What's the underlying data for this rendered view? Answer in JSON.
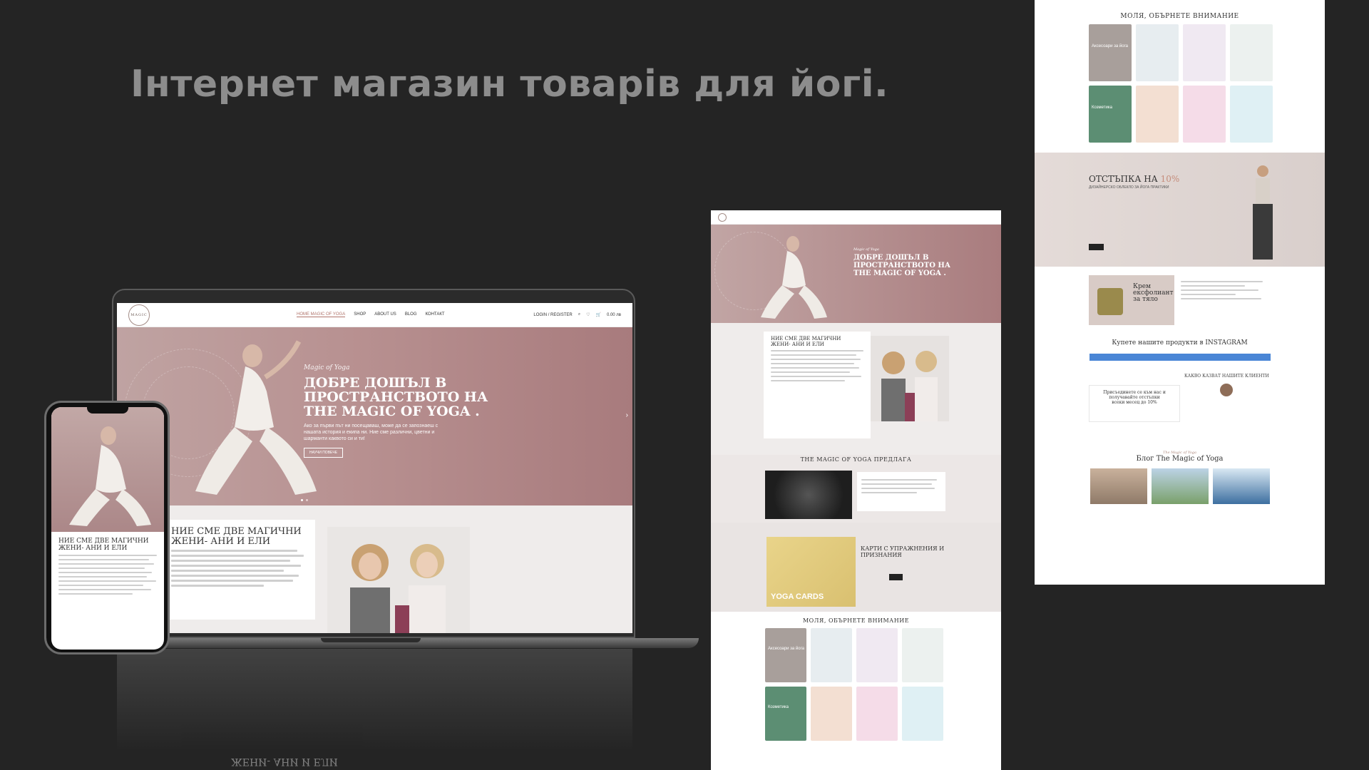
{
  "headline": "Інтернет магазин товарів для йогі.",
  "laptop": {
    "logo": "MAGIC",
    "menu": [
      "HOME MAGIC OF YOGA",
      "SHOP",
      "ABOUT US",
      "BLOG",
      "КОНТАКТ"
    ],
    "login": "LOGIN / REGISTER",
    "cart": "0.00 лв",
    "hero": {
      "kicker": "Magic of Yoga",
      "title_lines": [
        "ДОБРЕ ДОШЪЛ В",
        "ПРОСТРАНСТВОТО НА",
        "THE MAGIC OF YOGA ."
      ],
      "subtitle": "Ако за първи път ни посещаваш, може да се запознаеш с нашата история и екипа ни. Ние сме различни, цветни и шарманти каквото си и ти!",
      "button": "НАУЧИ ПОВЕЧЕ"
    },
    "about": {
      "title_lines": [
        "НИЕ СМЕ ДВЕ МАГИЧНИ",
        "ЖЕНИ- АНИ И ЕЛИ"
      ]
    }
  },
  "phone": {
    "about_title_lines": [
      "НИЕ СМЕ ДВЕ МАГИЧНИ",
      "ЖЕНИ- АНИ И ЕЛИ"
    ]
  },
  "reflection_text": "ЖЕНИ- АНИ И ЕЛИ",
  "mid": {
    "hero": {
      "kicker": "Magic of Yoga",
      "title_lines": [
        "ДОБРЕ ДОШЪЛ В",
        "ПРОСТРАНСТВОТО НА",
        "THE MAGIC OF YOGA ."
      ]
    },
    "about_title_lines": [
      "НИЕ СМЕ ДВЕ МАГИЧНИ",
      "ЖЕНИ- АНИ И ЕЛИ"
    ],
    "offers_title": "THE MAGIC OF YOGA ПРЕДЛАГА",
    "cards_title_lines": [
      "КАРТИ С УПРАЖНЕНИЯ И",
      "ПРИЗНАНИЯ"
    ],
    "cards_label": "YOGA CARDS",
    "attention_title": "МОЛЯ, ОБЪРНЕТЕ ВНИМАНИЕ",
    "tiles": [
      "Аксесоари за йога",
      "Козметика"
    ]
  },
  "right": {
    "attention_title": "МОЛЯ, ОБЪРНЕТЕ ВНИМАНИЕ",
    "tiles": [
      "Аксесоари за йога",
      "Козметика"
    ],
    "discount_title": "ОТСТЪПКА НА",
    "discount_pct": "10%",
    "discount_sub": "ДИЗАЙНЕРСКО ОБЛЕКЛО ЗА ЙОГА ПРАКТИКИ",
    "scrub_lines": [
      "Крем",
      "ексфолиант",
      "за тяло"
    ],
    "instagram_title": "Купете нашите продукти в INSTAGRAM",
    "reviews_title": "КАКВО КАЗВАТ НАШИТЕ КЛИЕНТИ",
    "newsletter_lines": [
      "Присъединете се към нас и",
      "получавайте отстъпки",
      "всеки месец до 10%"
    ],
    "blog_kicker": "The Magic of Yoga",
    "blog_title": "Блог The Magic of Yoga"
  }
}
